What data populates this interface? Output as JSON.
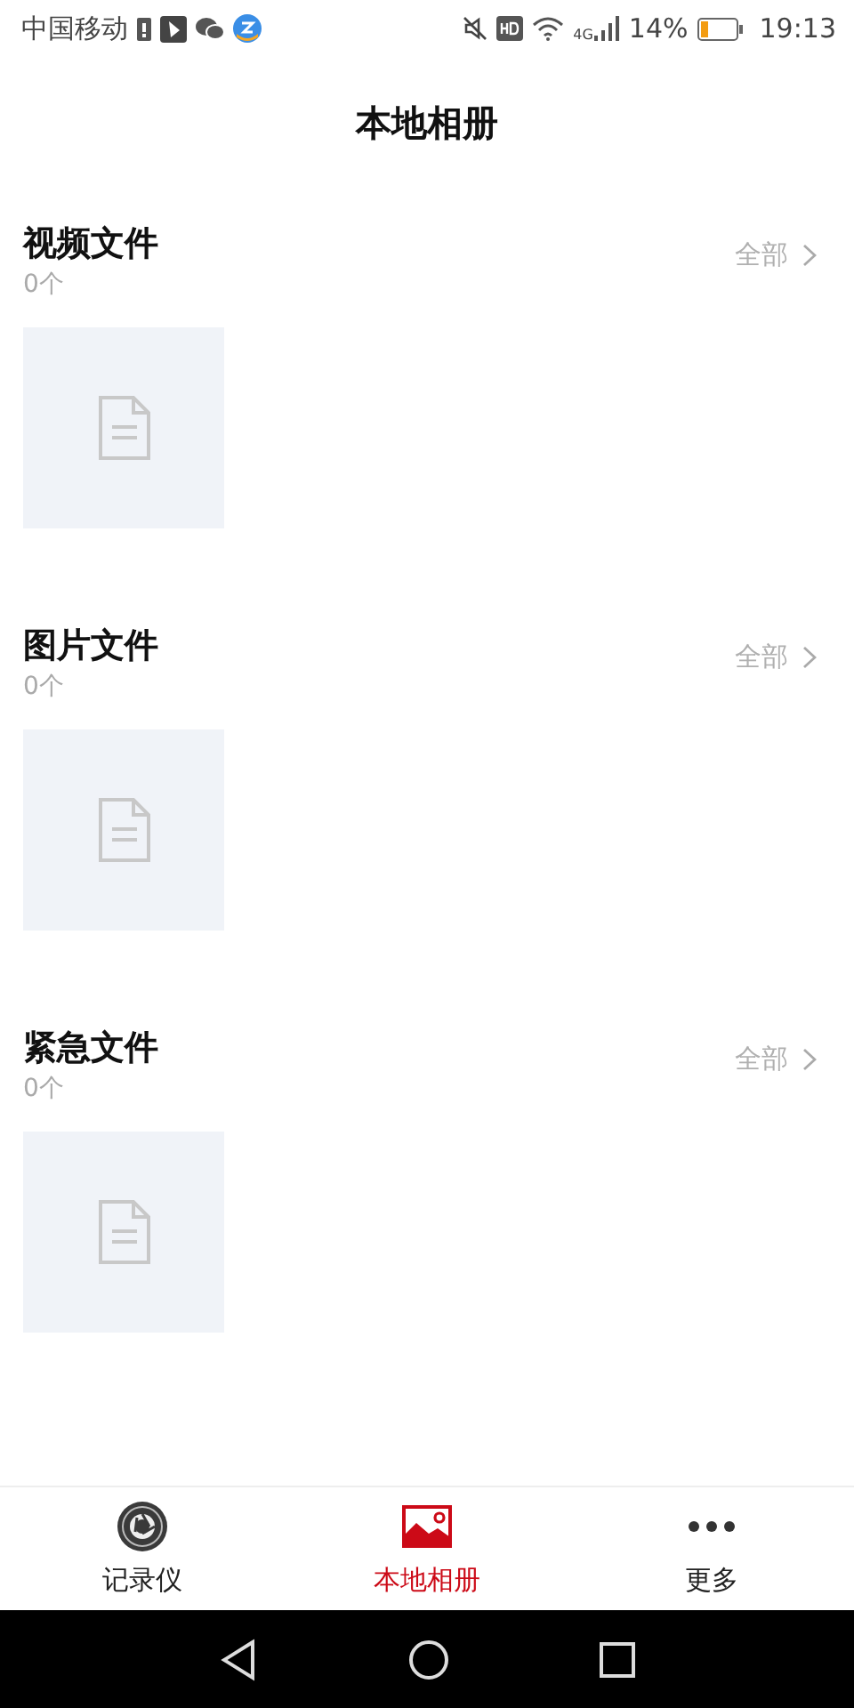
{
  "status_bar": {
    "carrier": "中国移动",
    "network": "4G",
    "battery": "14%",
    "time": "19:13"
  },
  "header": {
    "title": "本地相册"
  },
  "sections": [
    {
      "title": "视频文件",
      "count": "0个",
      "more": "全部"
    },
    {
      "title": "图片文件",
      "count": "0个",
      "more": "全部"
    },
    {
      "title": "紧急文件",
      "count": "0个",
      "more": "全部"
    }
  ],
  "tabs": [
    {
      "kind": "recorder",
      "label": "记录仪",
      "selected": false
    },
    {
      "kind": "album",
      "label": "本地相册",
      "selected": true
    },
    {
      "kind": "more",
      "label": "更多",
      "selected": false
    }
  ]
}
